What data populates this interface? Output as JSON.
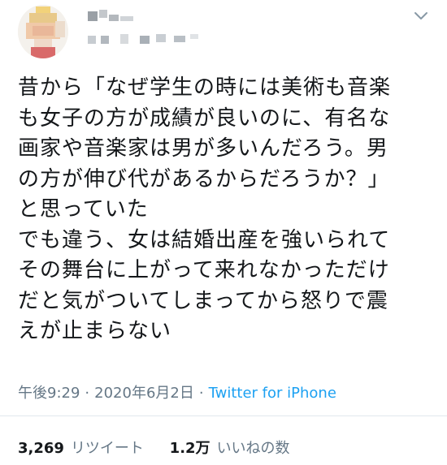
{
  "tweet": {
    "text": "昔から「なぜ学生の時には美術も音楽\nも女子の方が成績が良いのに、有名な\n画家や音楽家は男が多いんだろう。男\nの方が伸び代があるからだろうか？」\nと思っていた\nでも違う、女は結婚出産を強いられて\nその舞台に上がって来れなかっただけ\nだと気がついてしまってから怒りで震\nえが止まらない",
    "time": "午後9:29",
    "separator": "·",
    "date": "2020年6月2日",
    "source": "Twitter for iPhone"
  },
  "stats": {
    "retweets_count": "3,269",
    "retweets_label": "リツイート",
    "likes_count": "1.2万",
    "likes_label": "いいねの数"
  },
  "colors": {
    "text": "#14171a",
    "secondary": "#657786",
    "link": "#1da1f2",
    "divider": "#e1e8ed"
  },
  "icons": {
    "avatar": "blurred-avatar",
    "menu": "chevron-down-icon"
  }
}
